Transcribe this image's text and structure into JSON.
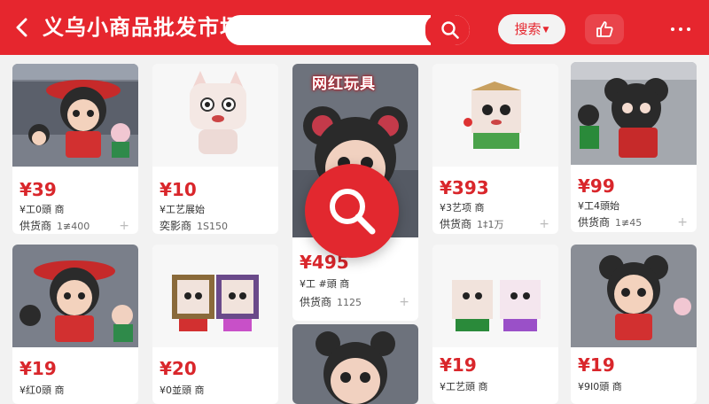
{
  "header": {
    "title": "义乌小商品批发市场",
    "search_placeholder": "",
    "sort_label": "搜索",
    "icons": {
      "back": "back-arrow-icon",
      "search": "search-icon",
      "share": "thumbs-up-icon",
      "more": "more-dots-icon"
    }
  },
  "colors": {
    "brand": "#e6262e",
    "price": "#d9262b"
  },
  "products": [
    {
      "price": "¥39",
      "line1": "¥工0頭 商",
      "line2": "供货商",
      "line2_num": "1≢400"
    },
    {
      "price": "¥10",
      "line1": "¥工艺展始",
      "line2": "奕影商",
      "line2_num": "1S150"
    },
    {
      "price": "¥495",
      "line1": "¥工 #頭 商",
      "line2": "供货商",
      "line2_num": "1125",
      "tag": "网红玩具"
    },
    {
      "price": "¥393",
      "line1": "¥3艺项 商",
      "line2": "供货商",
      "line2_num": "1‡1万"
    },
    {
      "price": "¥99",
      "line1": "¥工4頭始",
      "line2": "供货商",
      "line2_num": "1≢45"
    },
    {
      "price": "¥19",
      "line1": "¥红0頭 商",
      "line2": "",
      "line2_num": ""
    },
    {
      "price": "¥20",
      "line1": "¥0並頭 商",
      "line2": "",
      "line2_num": ""
    },
    {
      "price": "",
      "line1": "",
      "line2": "",
      "line2_num": ""
    },
    {
      "price": "¥19",
      "line1": "¥工艺頭 商",
      "line2": "",
      "line2_num": ""
    },
    {
      "price": "¥19",
      "line1": "¥9I0頭 商",
      "line2": "",
      "line2_num": ""
    }
  ]
}
